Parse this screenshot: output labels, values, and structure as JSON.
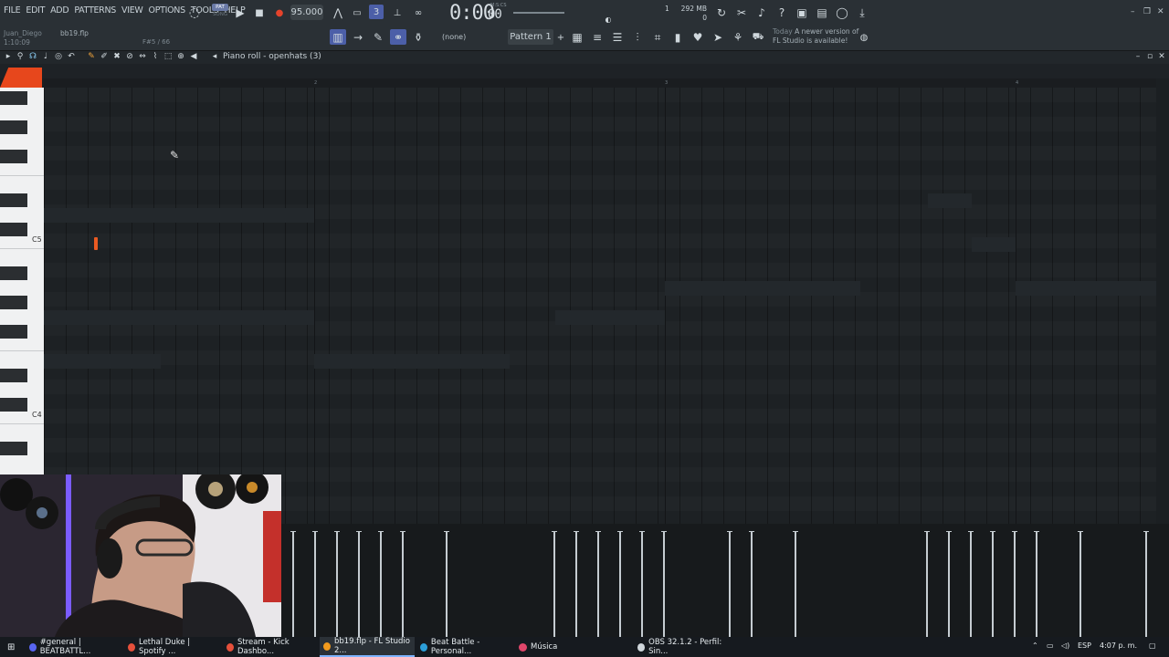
{
  "menu": [
    "FILE",
    "EDIT",
    "ADD",
    "PATTERNS",
    "VIEW",
    "OPTIONS",
    "TOOLS",
    "HELP"
  ],
  "transport": {
    "pat_label": "PAT",
    "song_label": "SONG",
    "tempo": "95.000",
    "time": "0:00",
    "time_frac": "00",
    "time_unit": "M:S:CS"
  },
  "status": {
    "user": "Juan_Diego",
    "project": "bb19.flp",
    "position": "1:10:09",
    "hint": "F#5 / 66",
    "cpu_value": "1",
    "memory": "292 MB",
    "polyphony": "0"
  },
  "toolbar2": {
    "channel_none": "(none)",
    "pattern": "Pattern 1",
    "news_today": "Today",
    "news_line1": "A newer version of",
    "news_line2": "FL Studio is available!"
  },
  "piano_roll": {
    "title": "Piano roll - openhats (3)",
    "ruler_marks": [
      "2",
      "3",
      "4"
    ],
    "key_labels": [
      "C5",
      "C4"
    ]
  },
  "taskbar": {
    "items": [
      {
        "label": "#general | BEATBATTL...",
        "color": "#5865f2"
      },
      {
        "label": "Lethal Duke | Spotify ...",
        "color": "#e5503b"
      },
      {
        "label": "Stream - Kick Dashbo...",
        "color": "#e5503b"
      },
      {
        "label": "bb19.flp - FL Studio 2...",
        "color": "#f29b1d"
      },
      {
        "label": "Beat Battle - Personal...",
        "color": "#2c9fd9"
      },
      {
        "label": "Música",
        "color": "#e0466a"
      },
      {
        "label": "OBS 32.1.2 - Perfil: Sin...",
        "color": "#cfd6db"
      }
    ],
    "language": "ESP",
    "clock": "4:07 p. m."
  }
}
